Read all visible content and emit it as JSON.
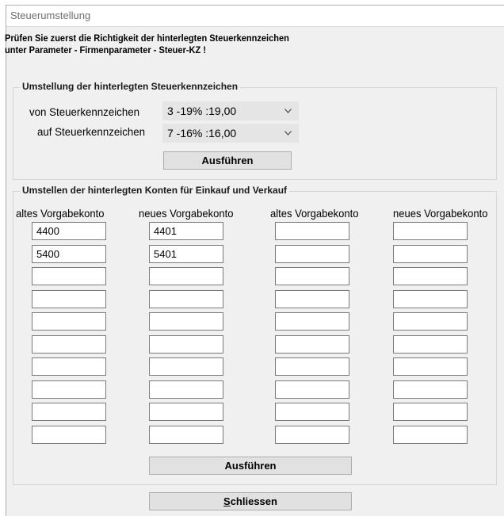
{
  "window": {
    "title": "Steuerumstellung"
  },
  "warning": {
    "line1": "Prüfen Sie zuerst die Richtigkeit der hinterlegten Steuerkennzeichen",
    "line2": "unter Parameter - Firmenparameter - Steuer-KZ !"
  },
  "tax_group": {
    "legend": "Umstellung der hinterlegten Steuerkennzeichen",
    "from_label": "von Steuerkennzeichen",
    "from_value": "3 -19%  :19,00",
    "to_label": "auf Steuerkennzeichen",
    "to_value": "7 -16%  :16,00",
    "run_button": "Ausführen"
  },
  "accounts_group": {
    "legend": "Umstellen der hinterlegten Konten für Einkauf und Verkauf",
    "headers": [
      "altes Vorgabekonto",
      "neues Vorgabekonto",
      "altes Vorgabekonto",
      "neues Vorgabekonto"
    ],
    "col1": [
      "4400",
      "5400",
      "",
      "",
      "",
      "",
      "",
      "",
      "",
      ""
    ],
    "col2": [
      "4401",
      "5401",
      "",
      "",
      "",
      "",
      "",
      "",
      "",
      ""
    ],
    "col3": [
      "",
      "",
      "",
      "",
      "",
      "",
      "",
      "",
      "",
      ""
    ],
    "col4": [
      "",
      "",
      "",
      "",
      "",
      "",
      "",
      "",
      "",
      ""
    ],
    "run_button": "Ausführen"
  },
  "close_button": {
    "mnemonic": "S",
    "rest": "chliessen"
  }
}
